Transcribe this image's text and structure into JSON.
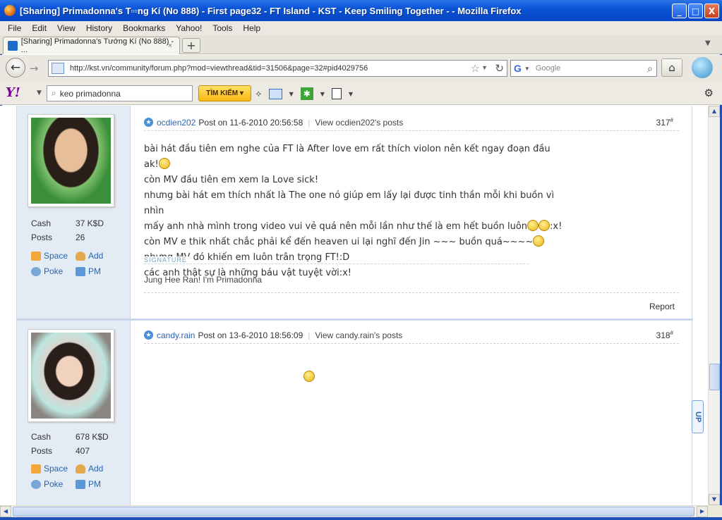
{
  "window": {
    "title": "[Sharing] Primadonna's T▫▫ng Kí (No 888) - First page32 - FT Island - KST - Keep Smiling Together - - Mozilla Firefox",
    "buttons": [
      "_",
      "□",
      "X"
    ]
  },
  "menu": [
    "File",
    "Edit",
    "View",
    "History",
    "Bookmarks",
    "Yahoo!",
    "Tools",
    "Help"
  ],
  "tab": {
    "label": "[Sharing] Primadonna's Tướng Kí (No 888) - ...",
    "close": "×",
    "new_tab": "+"
  },
  "nav": {
    "url": "http://kst.vn/community/forum.php?mod=viewthread&tid=31506&page=32#pid4029756",
    "search_placeholder": "Google",
    "search_engine_icon": "G"
  },
  "yahoo_toolbar": {
    "logo": "Y!",
    "search_value": "keo primadonna",
    "search_button": "TÌM KIẾM"
  },
  "posts": [
    {
      "author": "ocdien202",
      "date": "Post on 11-6-2010 20:56:58",
      "view_posts": "View ocdien202's posts",
      "number": "317",
      "sup": "#",
      "stats": [
        {
          "label": "Cash",
          "value": "37 K$D"
        },
        {
          "label": "Posts",
          "value": "26"
        }
      ],
      "links": [
        "Space",
        "Add",
        "Poke",
        "PM"
      ],
      "lines": [
        "bài hát đầu tiên em nghe của FT là After love em rất thích violon nên kết ngay đoạn đầu ak!",
        "còn MV đầu tiên em xem la Love sick!",
        "nhưng bài hát em thích nhất là The one nó giúp em lấy lại được tinh thần mỗi khi buồn vì nhìn",
        "mấy anh nhà mình trong video vui vẻ quá nên mỗi lần như thế là em hết buồn luôn",
        "còn MV e thik nhất chắc phải kể đến heaven ui lại nghĩ đến Jin ~~~ buồn quá~~~~",
        "nhưng MV đó khiến em luôn trân trọng FT!:D",
        "các anh thật sự là những báu vật tuyệt vời:x!"
      ],
      "line4_suffix": ":x!",
      "signature_label": "SIGNATURE",
      "signature": "Jung Hee Ran! I'm Primadonna",
      "report": "Report"
    },
    {
      "author": "candy.rain",
      "date": "Post on 13-6-2010 18:56:09",
      "view_posts": "View candy.rain's posts",
      "number": "318",
      "sup": "#",
      "stats": [
        {
          "label": "Cash",
          "value": "678 K$D"
        },
        {
          "label": "Posts",
          "value": "407"
        }
      ],
      "links": [
        "Space",
        "Add",
        "Poke",
        "PM"
      ]
    }
  ],
  "up_button": "UP"
}
